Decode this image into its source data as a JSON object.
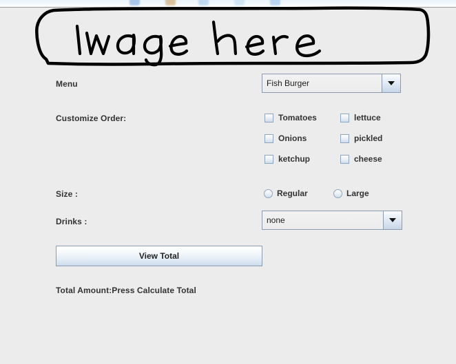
{
  "window": {
    "background_color": "#ececec",
    "toolbar_visible": true
  },
  "image_placeholder": {
    "text": "Image here",
    "style": "hand-drawn-rounded-rectangle",
    "stroke_color": "#000000"
  },
  "form": {
    "menu": {
      "label": "Menu",
      "selected": "Fish Burger",
      "options": [
        "Fish Burger"
      ]
    },
    "customize": {
      "label": "Customize Order:",
      "options": [
        {
          "label": "Tomatoes",
          "checked": false
        },
        {
          "label": "lettuce",
          "checked": false
        },
        {
          "label": "Onions",
          "checked": false
        },
        {
          "label": "pickled",
          "checked": false
        },
        {
          "label": "ketchup",
          "checked": false
        },
        {
          "label": "cheese",
          "checked": false
        }
      ]
    },
    "size": {
      "label": "Size :",
      "options": [
        {
          "label": "Regular",
          "selected": false
        },
        {
          "label": "Large",
          "selected": false
        }
      ]
    },
    "drinks": {
      "label": "Drinks :",
      "selected": "none",
      "options": [
        "none"
      ]
    },
    "view_total_button": "View Total",
    "total_amount": "Total Amount:Press Calculate Total"
  }
}
